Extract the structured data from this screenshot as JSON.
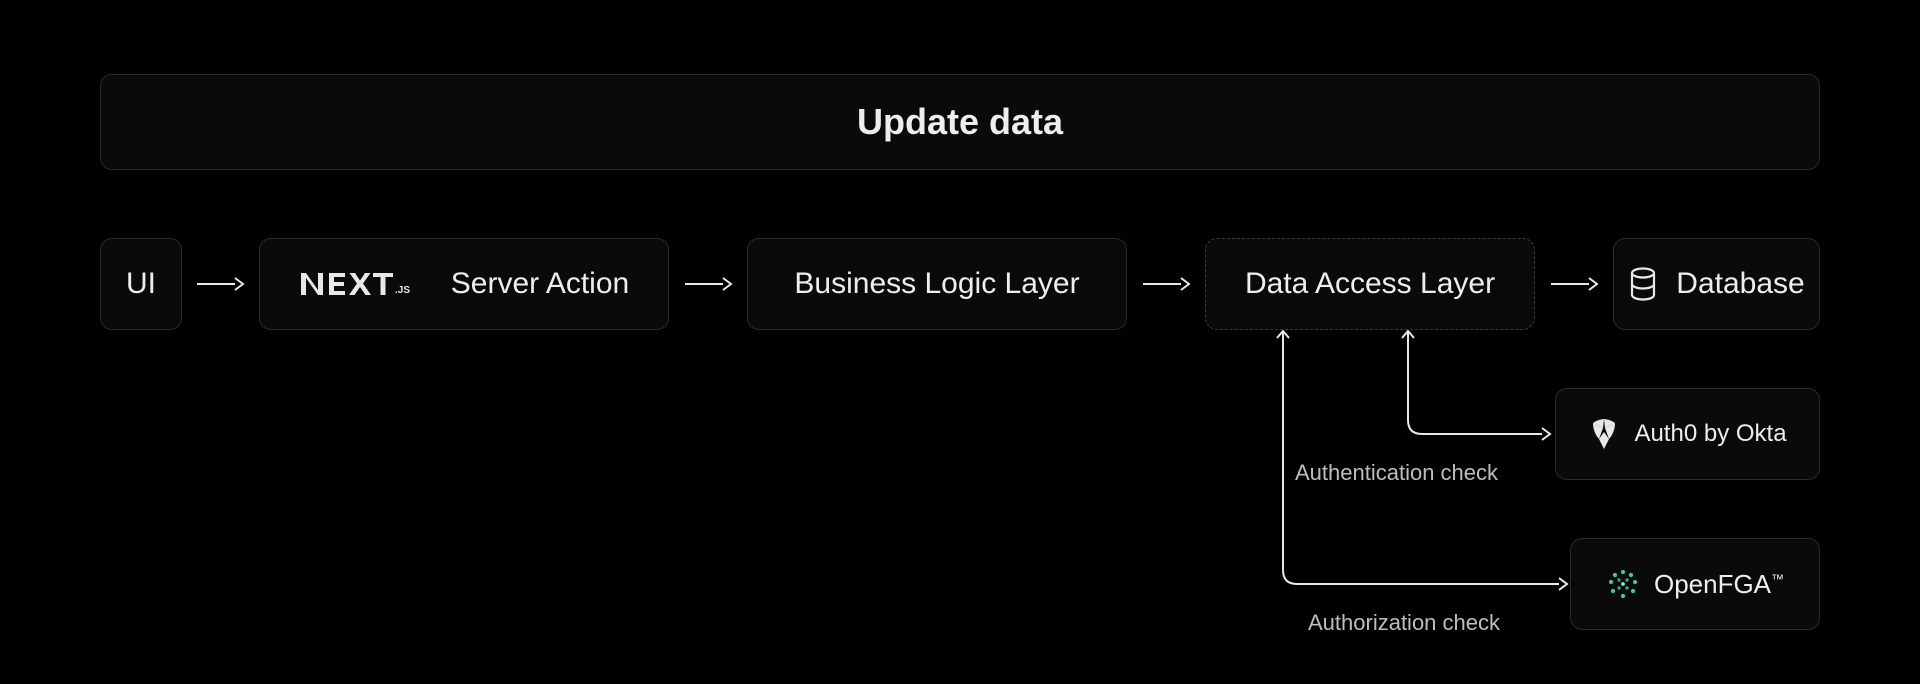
{
  "banner": {
    "title": "Update data"
  },
  "nodes": {
    "ui": {
      "label": "UI"
    },
    "next": {
      "brand": "NEXT.js",
      "label": "Server Action"
    },
    "bll": {
      "label": "Business Logic Layer"
    },
    "dal": {
      "label": "Data Access Layer"
    },
    "db": {
      "label": "Database"
    },
    "auth0": {
      "label": "Auth0 by Okta"
    },
    "openfga": {
      "label": "OpenFGA",
      "tm": "™"
    }
  },
  "edges": {
    "auth_check": {
      "label": "Authentication check"
    },
    "authz_check": {
      "label": "Authorization check"
    }
  }
}
